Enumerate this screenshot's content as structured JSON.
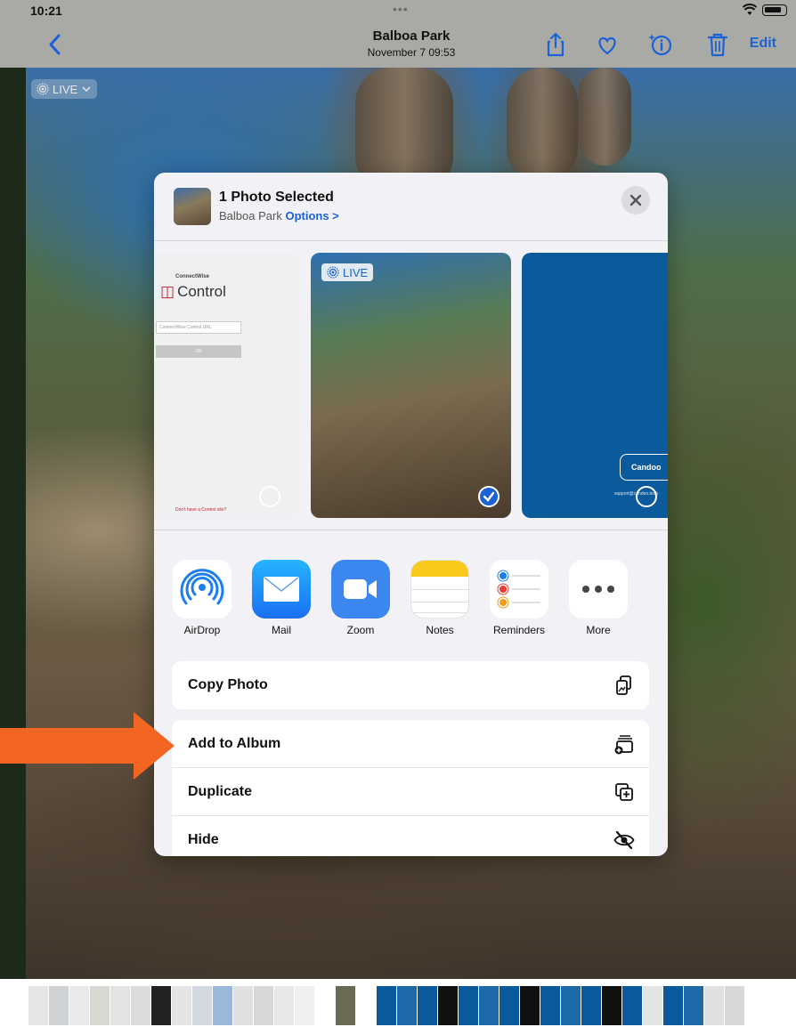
{
  "status_bar": {
    "time": "10:21",
    "dots": "•••"
  },
  "nav": {
    "title": "Balboa Park",
    "subtitle": "November 7  09:53",
    "edit_label": "Edit",
    "icons": [
      "back-chevron-icon",
      "share-icon",
      "heart-icon",
      "info-sparkle-icon",
      "trash-icon"
    ]
  },
  "live_badge": {
    "label": "LIVE"
  },
  "sheet": {
    "title": "1 Photo Selected",
    "subtitle": "Balboa Park",
    "options_label": "Options >",
    "carousel": {
      "left_card": {
        "brand_small": "ConnectWise",
        "brand": "Control",
        "input_placeholder": "ConnectWise Control URL",
        "button": "OK",
        "footer": "Don't have a Control site?"
      },
      "middle_card": {
        "live_label": "LIVE",
        "selected": true
      },
      "right_card": {
        "button": "Candoo",
        "footer": "support@candoo.tech"
      }
    },
    "apps": [
      {
        "label": "AirDrop",
        "icon": "airdrop-icon"
      },
      {
        "label": "Mail",
        "icon": "mail-icon"
      },
      {
        "label": "Zoom",
        "icon": "zoom-icon"
      },
      {
        "label": "Notes",
        "icon": "notes-icon"
      },
      {
        "label": "Reminders",
        "icon": "reminders-icon"
      },
      {
        "label": "More",
        "icon": "more-icon"
      }
    ],
    "actions_group1": [
      {
        "label": "Copy Photo",
        "icon": "copy-photo-icon"
      }
    ],
    "actions_group2": [
      {
        "label": "Add to Album",
        "icon": "add-to-album-icon"
      },
      {
        "label": "Duplicate",
        "icon": "duplicate-icon"
      },
      {
        "label": "Hide",
        "icon": "hide-eye-slash-icon"
      }
    ]
  },
  "annotation": {
    "arrow_color": "#f26522",
    "points_to": "Add to Album"
  },
  "colors": {
    "accent": "#1b62d6",
    "bar": "#a9aaa6",
    "sheet_bg": "#f2f2f6"
  }
}
